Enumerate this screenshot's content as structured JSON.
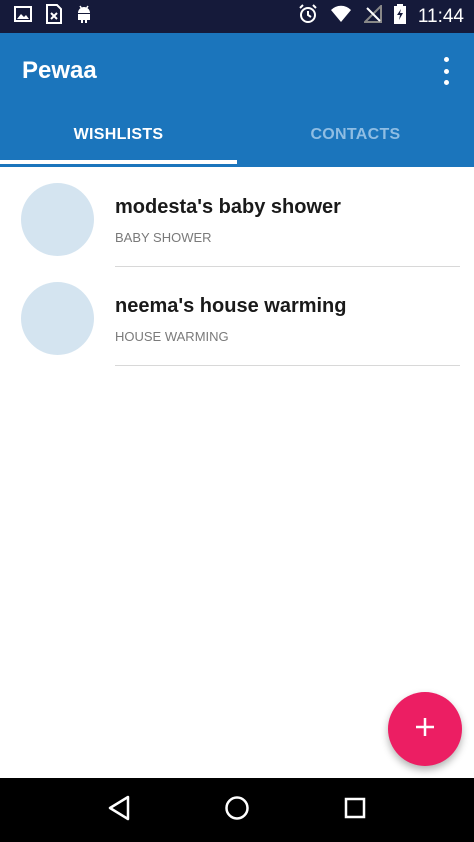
{
  "status_bar": {
    "time": "11:44",
    "left_icons": [
      "image-icon",
      "sim-card-icon",
      "android-icon"
    ],
    "right_icons": [
      "alarm-icon",
      "wifi-icon",
      "no-signal-icon",
      "battery-charging-icon"
    ]
  },
  "app_bar": {
    "title": "Pewaa",
    "color": "#1b75bc"
  },
  "tabs": [
    {
      "label": "WISHLISTS",
      "active": true
    },
    {
      "label": "CONTACTS",
      "active": false
    }
  ],
  "wishlists": [
    {
      "title": "modesta's baby shower",
      "subtitle": "BABY SHOWER"
    },
    {
      "title": "neema's house warming",
      "subtitle": "HOUSE WARMING"
    }
  ],
  "fab": {
    "icon": "plus-icon",
    "color": "#ec1e63"
  },
  "nav_bar": {
    "buttons": [
      "back-icon",
      "home-icon",
      "recents-icon"
    ]
  }
}
